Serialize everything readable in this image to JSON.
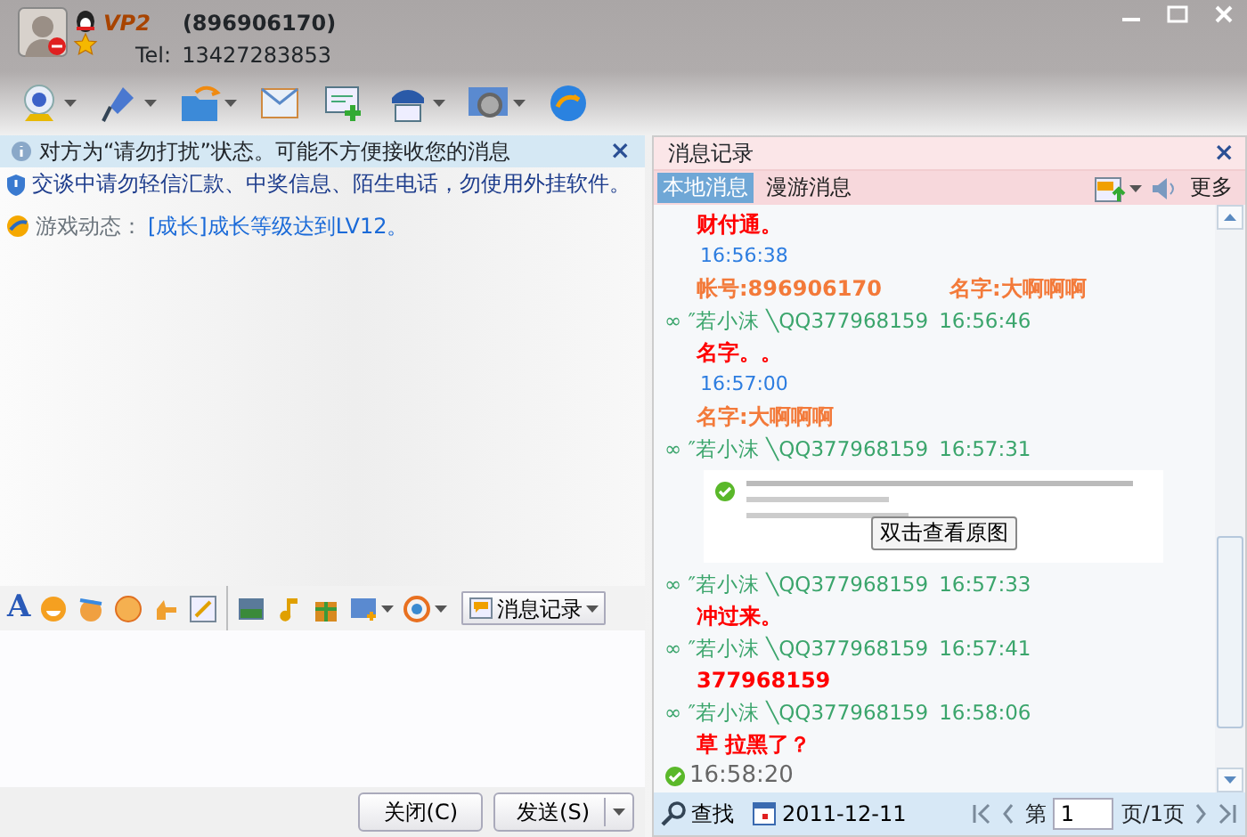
{
  "contact": {
    "vip": "VP2",
    "qq": "(896906170)",
    "tel_label": "Tel:",
    "tel": "13427283853"
  },
  "notice": {
    "text": "对方为“请勿打扰”状态。可能不方便接收您的消息",
    "close": "×"
  },
  "warning": "交谈中请勿轻信汇款、中奖信息、陌生电话，勿使用外挂软件。",
  "game": {
    "label": "游戏动态：",
    "link": "[成长]成长等级达到LV12。"
  },
  "format_toolbar": {
    "font_button": "A",
    "history_button": "消息记录"
  },
  "buttons": [
    {
      "label": "关闭(C)",
      "kind": "plain"
    },
    {
      "label": "发送(S)",
      "kind": "split"
    }
  ],
  "history": {
    "title": "消息记录",
    "close": "×",
    "tabs": [
      {
        "label": "本地消息",
        "selected": true
      },
      {
        "label": "漫游消息",
        "selected": false
      }
    ],
    "more": "更多",
    "messages": [
      {
        "kind": "body",
        "text": "财付通。"
      },
      {
        "kind": "time",
        "text": "16:56:38"
      },
      {
        "kind": "fields",
        "parts": [
          "帐号:896906170",
          "名字:大啊啊啊"
        ]
      },
      {
        "kind": "sender",
        "name": "∞ ″若小沫 ╲QQ377968159",
        "time": "16:56:46"
      },
      {
        "kind": "body",
        "text": "名字。。"
      },
      {
        "kind": "time",
        "text": "16:57:00"
      },
      {
        "kind": "fields",
        "parts": [
          "名字:大啊啊啊"
        ]
      },
      {
        "kind": "sender",
        "name": "∞ ″若小沫 ╲QQ377968159",
        "time": "16:57:31"
      },
      {
        "kind": "image",
        "button": "双击查看原图"
      },
      {
        "kind": "sender",
        "name": "∞ ″若小沫 ╲QQ377968159",
        "time": "16:57:33"
      },
      {
        "kind": "body",
        "text": "冲过来。"
      },
      {
        "kind": "sender",
        "name": "∞ ″若小沫 ╲QQ377968159",
        "time": "16:57:41"
      },
      {
        "kind": "body",
        "text": "377968159"
      },
      {
        "kind": "sender",
        "name": "∞ ″若小沫 ╲QQ377968159",
        "time": "16:58:06"
      },
      {
        "kind": "body",
        "text": "草  拉黑了？"
      },
      {
        "kind": "status",
        "text": "16:58:20"
      }
    ],
    "search": "查找",
    "date": "2011-12-11",
    "page_label": "第",
    "page": "1",
    "page_total": "页/1页"
  }
}
